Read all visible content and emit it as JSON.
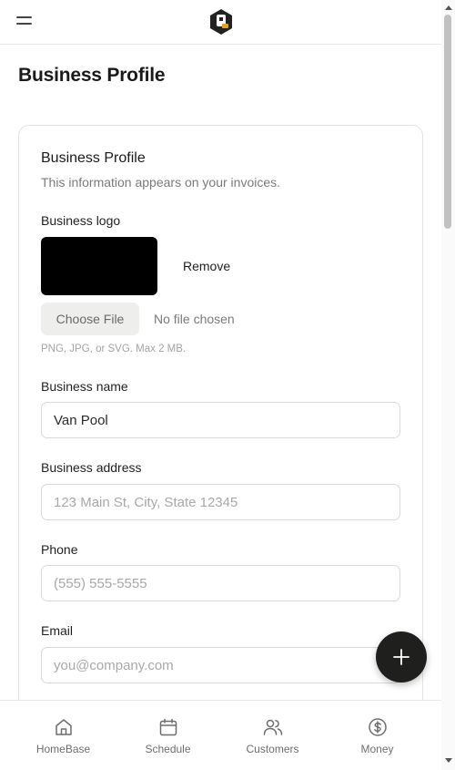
{
  "header": {
    "menu_icon": "menu-icon",
    "logo_icon": "brand-logo",
    "logo_letter": "P"
  },
  "page": {
    "title": "Business Profile"
  },
  "card": {
    "title": "Business Profile",
    "subtitle": "This information appears on your invoices."
  },
  "logo_section": {
    "label": "Business logo",
    "remove_label": "Remove",
    "choose_file_label": "Choose File",
    "no_file_text": "No file chosen",
    "hint": "PNG, JPG, or SVG. Max 2 MB."
  },
  "fields": {
    "business_name": {
      "label": "Business name",
      "value": "Van Pool",
      "placeholder": ""
    },
    "business_address": {
      "label": "Business address",
      "value": "",
      "placeholder": "123 Main St, City, State 12345"
    },
    "phone": {
      "label": "Phone",
      "value": "",
      "placeholder": "(555) 555-5555"
    },
    "email": {
      "label": "Email",
      "value": "",
      "placeholder": "you@company.com"
    }
  },
  "fab": {
    "icon": "plus-icon"
  },
  "bottom_nav": {
    "items": [
      {
        "label": "HomeBase",
        "icon": "home-icon"
      },
      {
        "label": "Schedule",
        "icon": "calendar-icon"
      },
      {
        "label": "Customers",
        "icon": "users-icon"
      },
      {
        "label": "Money",
        "icon": "dollar-circle-icon"
      }
    ]
  },
  "colors": {
    "fab_background": "#1f1f1d",
    "logo_accent": "#e8a21a",
    "logo_dark": "#222222"
  }
}
